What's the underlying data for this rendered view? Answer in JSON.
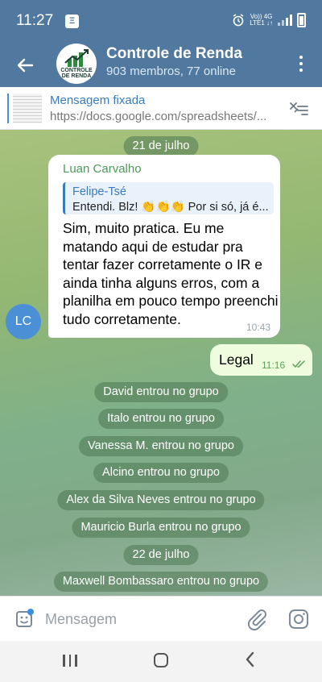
{
  "status_bar": {
    "time": "11:27",
    "notification_badge": "Ξ",
    "net_label_top": "Vo)) 4G",
    "net_label_bottom": "LTE1 ↓↑"
  },
  "header": {
    "title": "Controle de Renda",
    "subtitle": "903 membros, 77 online",
    "avatar_text": "CONTROLE DE RENDA"
  },
  "pinned": {
    "title": "Mensagem fixada",
    "url": "https://docs.google.com/spreadsheets/..."
  },
  "chat": {
    "date_1": "21 de julho",
    "incoming": {
      "sender": "Luan Carvalho",
      "quote_author": "Felipe-Tsé",
      "quote_text": "Entendi. Blz! 👏👏👏 Por si só, já é...",
      "text": "Sim, muito pratica. Eu me matando aqui de estudar pra tentar fazer corretamente o IR e ainda tinha alguns erros, com a planilha em pouco tempo preenchi tudo corretamente.",
      "time": "10:43",
      "avatar_initials": "LC"
    },
    "outgoing": {
      "text": "Legal",
      "time": "11:16"
    },
    "events_1": [
      "David entrou no grupo",
      "Italo entrou no grupo",
      "Vanessa M. entrou no grupo",
      "Alcino entrou no grupo",
      "Alex da Silva Neves entrou no grupo",
      "Mauricio Burla entrou no grupo"
    ],
    "date_2": "22 de julho",
    "events_2": [
      "Maxwell Bombassaro entrou no grupo"
    ]
  },
  "composer": {
    "placeholder": "Mensagem"
  },
  "colors": {
    "header_bg": "#51799f",
    "link_blue": "#3a7bbb",
    "sender_green": "#4c9a5b",
    "outgoing_bubble": "#effdde",
    "avatar_blue": "#4b8fd6"
  },
  "icons": [
    "back-arrow",
    "more-vertical",
    "unpin",
    "sticker",
    "paperclip",
    "camera",
    "double-check",
    "nav-recents",
    "nav-home",
    "nav-back"
  ]
}
